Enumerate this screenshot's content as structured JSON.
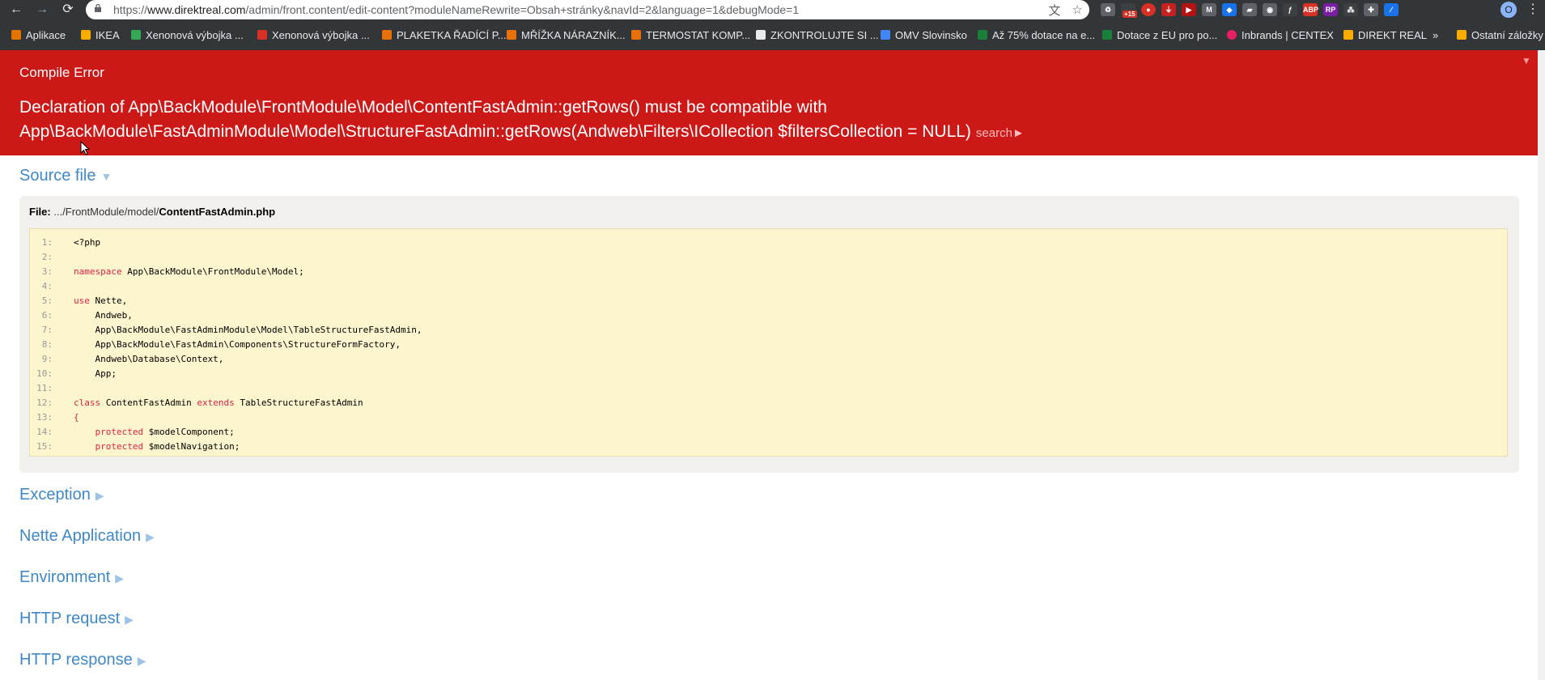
{
  "browser": {
    "url_prefix": "https://",
    "url_host": "www.direktreal.com",
    "url_path": "/admin/front.content/edit-content?moduleNameRewrite=Obsah+stránky&navId=2&language=1&debugMode=1",
    "profile_initial": "O",
    "extension_badge": "+15"
  },
  "bookmarks": [
    {
      "label": "Aplikace",
      "icon": "apps-grid-icon"
    },
    {
      "label": "IKEA",
      "icon": "folder-icon"
    },
    {
      "label": "Xenonová výbojka ...",
      "icon": "xenon-green-icon"
    },
    {
      "label": "Xenonová výbojka ...",
      "icon": "xenon-red-icon"
    },
    {
      "label": "PLAKETKA ŘADÍCÍ P...",
      "icon": "shop-orange-icon"
    },
    {
      "label": "MŘÍŽKA NÁRAZNÍK...",
      "icon": "shop-orange-icon"
    },
    {
      "label": "TERMOSTAT KOMP...",
      "icon": "shop-orange-icon"
    },
    {
      "label": "ZKONTROLUJTE SI ...",
      "icon": "page-icon"
    },
    {
      "label": "OMV Slovinsko",
      "icon": "maps-icon"
    },
    {
      "label": "Až 75% dotace na e...",
      "icon": "site-green-icon"
    },
    {
      "label": "Dotace z EU pro po...",
      "icon": "site-green-icon"
    },
    {
      "label": "Inbrands | CENTEX",
      "icon": "site-pink-icon"
    },
    {
      "label": "DIREKT REAL",
      "icon": "folder-icon"
    },
    {
      "label": "»",
      "icon": "more-bookmarks-icon"
    },
    {
      "label": "Ostatní záložky",
      "icon": "folder-icon"
    }
  ],
  "error": {
    "type": "Compile Error",
    "message_line1": "Declaration of App\\BackModule\\FrontModule\\Model\\ContentFastAdmin::getRows() must be compatible with",
    "message_line2": "App\\BackModule\\FastAdminModule\\Model\\StructureFastAdmin::getRows(Andweb\\Filters\\ICollection $filtersCollection = NULL)",
    "search_label": "search►"
  },
  "source": {
    "title": "Source file",
    "file_label": "File:",
    "file_dir": ".../FrontModule/model/",
    "file_name": "ContentFastAdmin.php",
    "lines": [
      {
        "n": "1:",
        "tokens": [
          {
            "t": "<?php",
            "k": false
          }
        ]
      },
      {
        "n": "2:",
        "tokens": []
      },
      {
        "n": "3:",
        "tokens": [
          {
            "t": "namespace",
            "k": true
          },
          {
            "t": " App\\BackModule\\FrontModule\\Model;",
            "k": false
          }
        ]
      },
      {
        "n": "4:",
        "tokens": []
      },
      {
        "n": "5:",
        "tokens": [
          {
            "t": "use",
            "k": true
          },
          {
            "t": " Nette,",
            "k": false
          }
        ]
      },
      {
        "n": "6:",
        "tokens": [
          {
            "t": "    Andweb,",
            "k": false
          }
        ]
      },
      {
        "n": "7:",
        "tokens": [
          {
            "t": "    App\\BackModule\\FastAdminModule\\Model\\TableStructureFastAdmin,",
            "k": false
          }
        ]
      },
      {
        "n": "8:",
        "tokens": [
          {
            "t": "    App\\BackModule\\FastAdmin\\Components\\StructureFormFactory,",
            "k": false
          }
        ]
      },
      {
        "n": "9:",
        "tokens": [
          {
            "t": "    Andweb\\Database\\Context,",
            "k": false
          }
        ]
      },
      {
        "n": "10:",
        "tokens": [
          {
            "t": "    App;",
            "k": false
          }
        ]
      },
      {
        "n": "11:",
        "tokens": []
      },
      {
        "n": "12:",
        "tokens": [
          {
            "t": "class",
            "k": true
          },
          {
            "t": " ContentFastAdmin ",
            "k": false
          },
          {
            "t": "extends",
            "k": true
          },
          {
            "t": " TableStructureFastAdmin",
            "k": false
          }
        ]
      },
      {
        "n": "13:",
        "tokens": [
          {
            "t": "{",
            "k": true
          }
        ]
      },
      {
        "n": "14:",
        "tokens": [
          {
            "t": "    ",
            "k": false
          },
          {
            "t": "protected",
            "k": true
          },
          {
            "t": " $modelComponent;",
            "k": false
          }
        ]
      },
      {
        "n": "15:",
        "tokens": [
          {
            "t": "    ",
            "k": false
          },
          {
            "t": "protected",
            "k": true
          },
          {
            "t": " $modelNavigation;",
            "k": false
          }
        ]
      }
    ]
  },
  "sections": [
    {
      "label": "Exception",
      "arrow": "▶"
    },
    {
      "label": "Nette Application",
      "arrow": "▶"
    },
    {
      "label": "Environment",
      "arrow": "▶"
    },
    {
      "label": "HTTP request",
      "arrow": "▶"
    },
    {
      "label": "HTTP response",
      "arrow": "▶"
    }
  ],
  "source_arrow": "▼"
}
